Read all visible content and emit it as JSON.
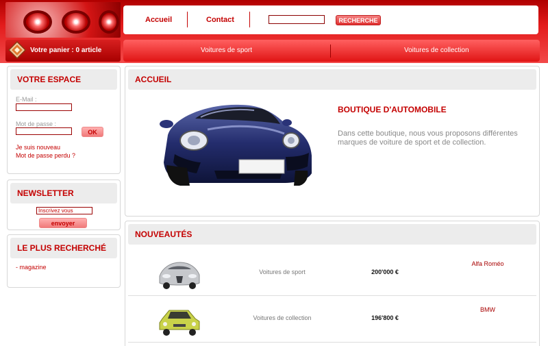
{
  "header": {
    "nav": {
      "home": "Accueil",
      "contact": "Contact"
    },
    "search": {
      "value": "",
      "button": "RECHERCHE"
    },
    "cart": {
      "text": "Votre panier : 0 article",
      "icon": "cart-icon"
    },
    "categories": [
      "Voitures de sport",
      "Voitures de collection"
    ]
  },
  "sidebar": {
    "account": {
      "title": "VOTRE ESPACE",
      "email_label": "E-Mail :",
      "password_label": "Mot de passe :",
      "ok_button": "OK",
      "new_user": "Je suis nouveau",
      "forgot_password": "Mot de passe perdu ?"
    },
    "newsletter": {
      "title": "NEWSLETTER",
      "placeholder": "Inscrivez vous",
      "button": "envoyer"
    },
    "popular": {
      "title": "LE PLUS RECHERCHÉ",
      "items": [
        "- magazine"
      ]
    }
  },
  "main": {
    "intro": {
      "heading": "ACCUEIL",
      "title": "BOUTIQUE D'AUTOMOBILE",
      "description": "Dans cette boutique, nous vous proposons différentes marques de voiture de sport et de collection."
    },
    "new_arrivals": {
      "heading": "NOUVEAUTÉS",
      "items": [
        {
          "category": "Voitures de sport",
          "price": "200'000 €",
          "brand": "Alfa Roméo",
          "color": "#c6c8cc"
        },
        {
          "category": "Voitures de collection",
          "price": "196'800 €",
          "brand": "BMW",
          "color": "#c9d24a"
        }
      ]
    }
  },
  "colors": {
    "accent": "#c40000",
    "header_red": "#e31b1b",
    "panel_grey": "#ececec"
  }
}
